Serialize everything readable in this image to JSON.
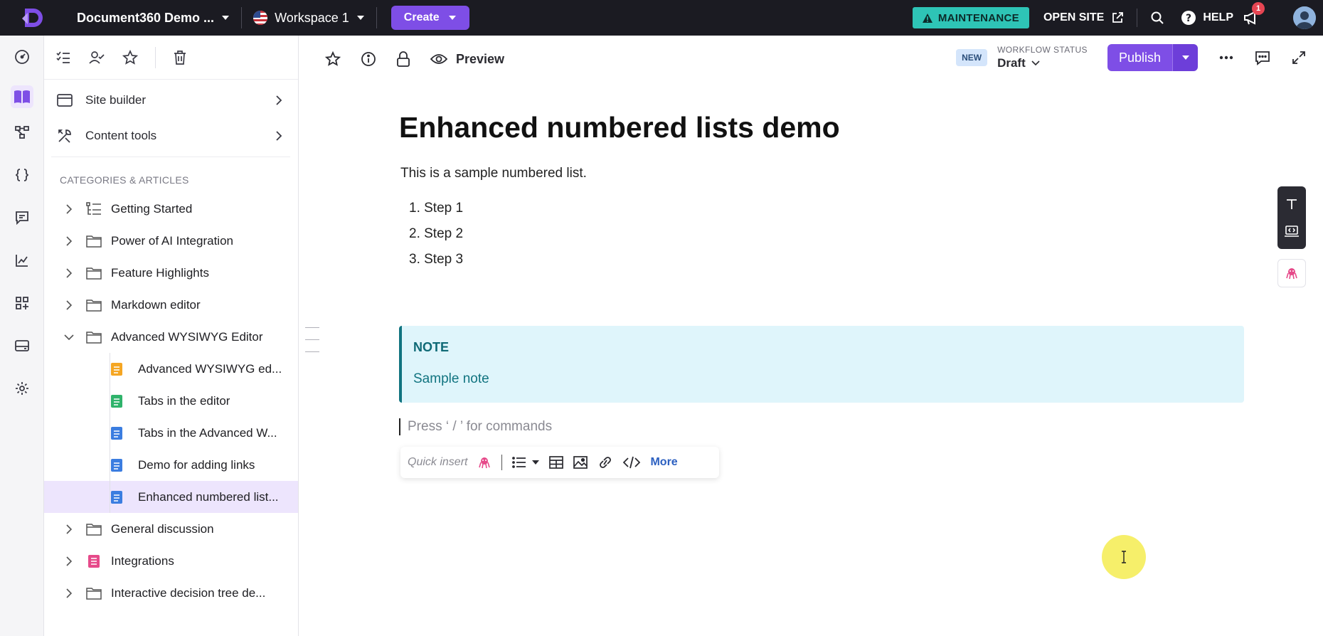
{
  "topbar": {
    "project_name": "Document360 Demo ...",
    "workspace": "Workspace 1",
    "create_label": "Create",
    "maintenance_label": "MAINTENANCE",
    "open_site_label": "OPEN SITE",
    "help_label": "HELP",
    "notification_count": "1",
    "accent_color": "#7e4ee6"
  },
  "rail": {
    "items": [
      "dashboard-icon",
      "documentation-icon",
      "api-hub-icon",
      "code-icon",
      "feedback-icon",
      "analytics-icon",
      "apps-icon",
      "widgets-icon",
      "settings-icon"
    ],
    "active_index": 1
  },
  "sidebar": {
    "links": [
      {
        "label": "Site builder",
        "icon": "browser-icon"
      },
      {
        "label": "Content tools",
        "icon": "tools-icon"
      }
    ],
    "categories_heading": "CATEGORIES & ARTICLES",
    "tree": [
      {
        "label": "Getting Started",
        "type": "category-index"
      },
      {
        "label": "Power of AI Integration",
        "type": "folder"
      },
      {
        "label": "Feature Highlights",
        "type": "folder"
      },
      {
        "label": "Markdown editor",
        "type": "folder"
      },
      {
        "label": "Advanced WYSIWYG Editor",
        "type": "folder",
        "expanded": true
      },
      {
        "label": "Advanced WYSIWYG ed...",
        "type": "article",
        "color": "#f5a623"
      },
      {
        "label": "Tabs in the editor",
        "type": "article",
        "color": "#2fb36b"
      },
      {
        "label": "Tabs in the Advanced W...",
        "type": "article",
        "color": "#3b7de0"
      },
      {
        "label": "Demo for adding links",
        "type": "article",
        "color": "#3b7de0"
      },
      {
        "label": "Enhanced numbered list...",
        "type": "article",
        "color": "#3b7de0",
        "selected": true
      },
      {
        "label": "General discussion",
        "type": "folder"
      },
      {
        "label": "Integrations",
        "type": "category-page",
        "color": "#e64a8a"
      },
      {
        "label": "Interactive decision tree de...",
        "type": "folder"
      }
    ]
  },
  "toolbar": {
    "preview_label": "Preview",
    "new_badge": "NEW",
    "workflow_label": "WORKFLOW STATUS",
    "workflow_value": "Draft",
    "publish_label": "Publish"
  },
  "article": {
    "title": "Enhanced numbered lists demo",
    "intro": "This is a sample numbered list.",
    "list": [
      "Step 1",
      "Step 2",
      "Step 3"
    ],
    "note_heading": "NOTE",
    "note_body": "Sample note",
    "command_placeholder": "Press ‘ / ’ for commands",
    "quick_insert_label": "Quick insert",
    "more_label": "More"
  }
}
